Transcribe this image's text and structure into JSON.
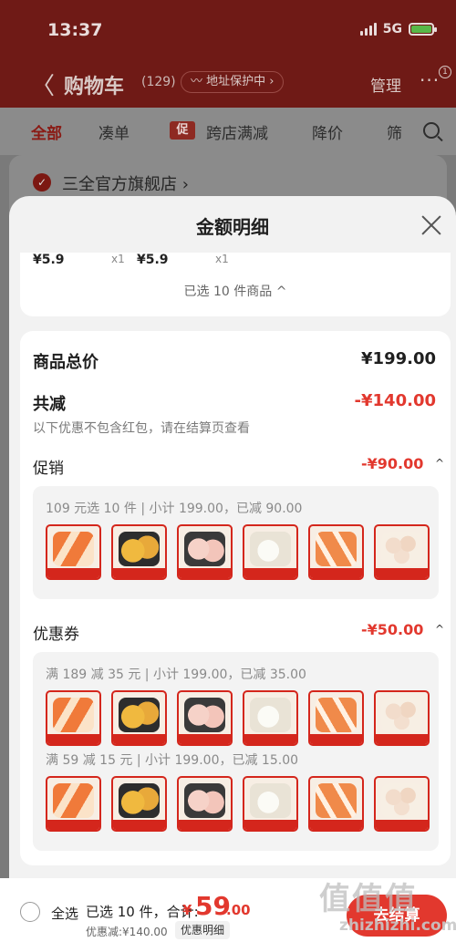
{
  "status_bar": {
    "time": "13:37",
    "network": "5G"
  },
  "header": {
    "back_label": "〈",
    "title": "购物车",
    "count": "(129)",
    "address_pill": "〰 地址保护中 ›",
    "manage_label": "管理",
    "more_label": "···",
    "more_badge": "1"
  },
  "tabs": [
    {
      "label": "全部"
    },
    {
      "label": "凑单"
    },
    {
      "label": "跨店满减",
      "icon": "促"
    },
    {
      "label": "降价"
    },
    {
      "label": "筛"
    }
  ],
  "store": {
    "name": "三全官方旗舰店 ›"
  },
  "sheet": {
    "title": "金额明细",
    "top_card": {
      "price_a": "¥5.9",
      "qty_a": "x1",
      "price_b": "¥5.9",
      "qty_b": "x1",
      "selected_note": "已选 10 件商品 ^"
    },
    "total": {
      "label": "商品总价",
      "value": "¥199.00"
    },
    "reduce": {
      "label": "共减",
      "value": "-¥140.00",
      "note": "以下优惠不包含红包，请在结算页查看"
    },
    "promo": {
      "label": "促销",
      "value": "-¥90.00",
      "chevron": "^",
      "groups": [
        {
          "title": "109 元选 10 件 | 小计 199.00，已减 90.00",
          "thumbs": [
            "crab-sticks",
            "golden-dumplings",
            "shrimp-balls",
            "steamed-buns",
            "fried-sticks",
            "meatballs"
          ]
        }
      ]
    },
    "coupon": {
      "label": "优惠券",
      "value": "-¥50.00",
      "chevron": "^",
      "groups": [
        {
          "title": "满 189 减 35 元 | 小计 199.00，已减 35.00",
          "thumbs": [
            "crab-sticks",
            "golden-dumplings",
            "shrimp-balls",
            "steamed-buns",
            "fried-sticks",
            "meatballs"
          ]
        },
        {
          "title": "满 59 减 15 元 | 小计 199.00，已减 15.00",
          "thumbs": [
            "crab-sticks",
            "golden-dumplings",
            "shrimp-balls",
            "steamed-buns",
            "fried-sticks",
            "meatballs"
          ]
        }
      ]
    }
  },
  "bottom_bar": {
    "select_all": "全选",
    "summary": "已选 10 件，合计:",
    "currency": "¥",
    "total_int": "59",
    "total_dec": ".00",
    "discount": "优惠减:¥140.00",
    "detail_chip": "优惠明细",
    "checkout": "去结算"
  },
  "watermark": {
    "text": "值值值",
    "url": "zhizhizhi.com"
  },
  "colors": {
    "accent": "#e2382e",
    "header_dim": "#6f1a16"
  }
}
